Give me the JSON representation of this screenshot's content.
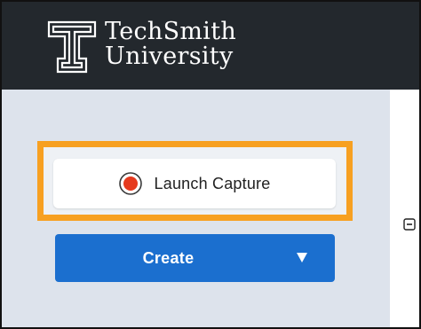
{
  "header": {
    "logo_line1": "TechSmith",
    "logo_line2": "University",
    "background": "#23282d"
  },
  "sidebar": {
    "background": "#dde3ec",
    "highlight_color": "#f7a021",
    "capture_button": {
      "label": "Launch Capture",
      "icon": "record-icon",
      "icon_color": "#e63a1e"
    },
    "create_button": {
      "label": "Create",
      "icon": "caret-down-icon",
      "color": "#1b6fcf"
    }
  },
  "main": {
    "collapse_icon": "collapse-minus-icon"
  }
}
